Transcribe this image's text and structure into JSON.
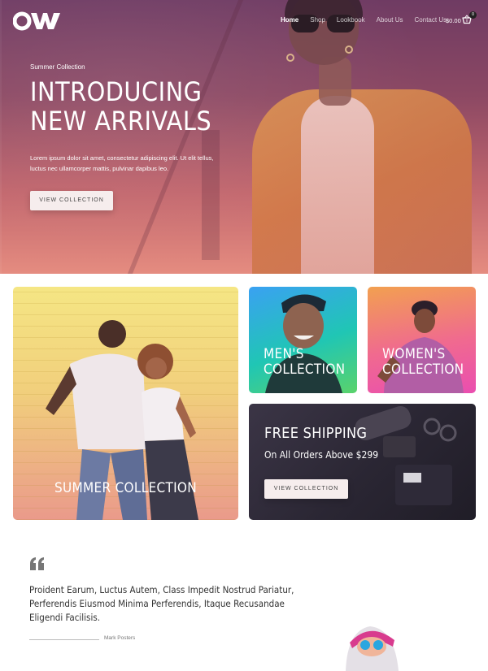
{
  "nav": {
    "items": [
      "Home",
      "Shop",
      "Lookbook",
      "About Us",
      "Contact Us"
    ],
    "active": "Home",
    "cart_total": "$0.00",
    "cart_count": "0"
  },
  "hero": {
    "eyebrow": "Summer Collection",
    "headline_1": "INTRODUCING",
    "headline_2": "NEW ARRIVALS",
    "lead": "Lorem ipsum dolor sit amet, consectetur adipiscing elit. Ut elit tellus, luctus nec ullamcorper mattis, pulvinar dapibus leo.",
    "button": "VIEW COLLECTION"
  },
  "cards": {
    "summer": {
      "title": "SUMMER COLLECTION"
    },
    "men": {
      "title_1": "MEN'S",
      "title_2": "COLLECTION"
    },
    "women": {
      "title_1": "WOMEN'S",
      "title_2": "COLLECTION"
    },
    "shipping": {
      "title": "FREE SHIPPING",
      "subtitle": "On All Orders Above $299",
      "button": "VIEW COLLECTION"
    }
  },
  "testimonial": {
    "quote": "Proident Earum, Luctus Autem, Class Impedit Nostrud Pariatur, Perferendis Eiusmod Minima Perferendis, Itaque Recusandae Eligendi Facilisis.",
    "author": "Mark Posters"
  },
  "colors": {
    "brand": "#ffffff",
    "hero_top": "#6f3b63",
    "hero_bottom": "#e58c80"
  }
}
